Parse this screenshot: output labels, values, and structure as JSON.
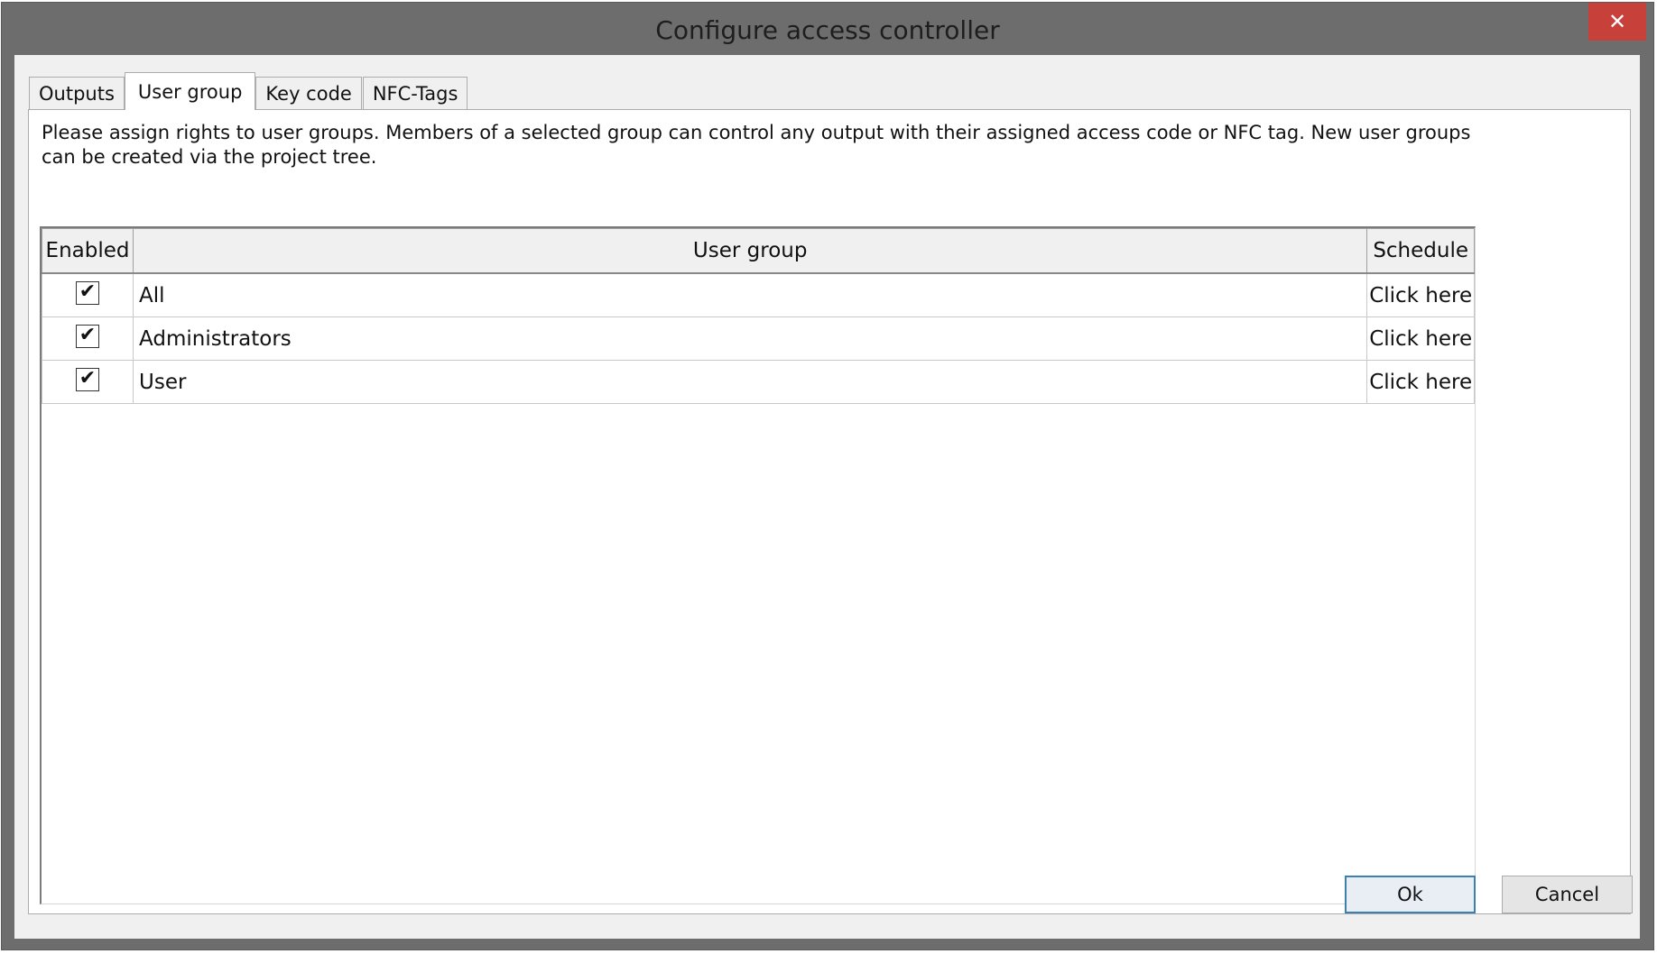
{
  "window": {
    "title": "Configure access controller",
    "close_glyph": "✕"
  },
  "tabs": [
    {
      "label": "Outputs",
      "active": false
    },
    {
      "label": "User group",
      "active": true
    },
    {
      "label": "Key code",
      "active": false
    },
    {
      "label": "NFC-Tags",
      "active": false
    }
  ],
  "description": "Please assign rights to user groups. Members of a selected group can control any output with their assigned access code or NFC tag. New user groups can be created via the project tree.",
  "table": {
    "columns": [
      "Enabled",
      "User group",
      "Schedule"
    ],
    "rows": [
      {
        "enabled": true,
        "group": "All",
        "schedule": "Click here"
      },
      {
        "enabled": true,
        "group": "Administrators",
        "schedule": "Click here"
      },
      {
        "enabled": true,
        "group": "User",
        "schedule": "Click here"
      }
    ],
    "check_glyph": "✔"
  },
  "buttons": {
    "ok": "Ok",
    "cancel": "Cancel"
  },
  "colors": {
    "frame": "#6d6d6d",
    "close_button": "#c7403a",
    "default_button_border": "#3c7fb1"
  }
}
